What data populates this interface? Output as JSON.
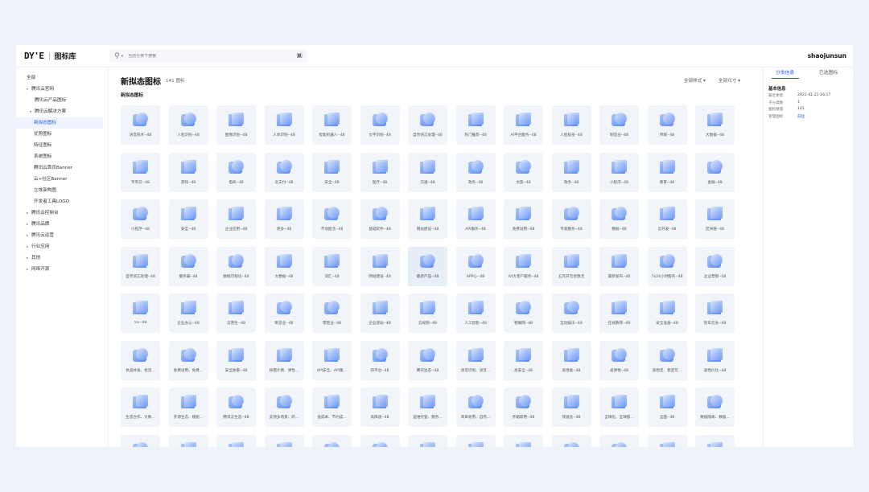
{
  "header": {
    "logo_text": "DY'E",
    "app_title": "图标库",
    "search_placeholder": "当前分类下搜索",
    "username": "shaojunsun"
  },
  "sidebar": {
    "items": [
      {
        "label": "全部",
        "level": 0,
        "expanded": null
      },
      {
        "label": "腾讯云官网",
        "level": 0,
        "expanded": true
      },
      {
        "label": "腾讯云产品图标",
        "level": 2,
        "expanded": null
      },
      {
        "label": "腾讯云解决方案",
        "level": 1,
        "expanded": true
      },
      {
        "label": "新拟态图标",
        "level": 1,
        "active": true,
        "expanded": null
      },
      {
        "label": "优势图标",
        "level": 1,
        "expanded": null
      },
      {
        "label": "特征图标",
        "level": 1,
        "expanded": null
      },
      {
        "label": "系统图标",
        "level": 1,
        "expanded": null
      },
      {
        "label": "腾讯云首页Banner",
        "level": 1,
        "expanded": null
      },
      {
        "label": "云+社区Banner",
        "level": 1,
        "expanded": null
      },
      {
        "label": "立体架构图",
        "level": 1,
        "expanded": null
      },
      {
        "label": "开发者工具LOGO",
        "level": 1,
        "expanded": null
      },
      {
        "label": "腾讯云控制台",
        "level": 0,
        "expanded": false
      },
      {
        "label": "腾讯品牌",
        "level": 0,
        "expanded": false
      },
      {
        "label": "腾讯云运营",
        "level": 0,
        "expanded": false
      },
      {
        "label": "行业应用",
        "level": 0,
        "expanded": false
      },
      {
        "label": "其他",
        "level": 0,
        "expanded": false
      },
      {
        "label": "网络开源",
        "level": 0,
        "expanded": false
      }
    ]
  },
  "main": {
    "title": "新拟态图标",
    "count": "141 图标",
    "filter_style": "全部样式",
    "filter_size": "全部尺寸",
    "section_label": "新拟态图标",
    "icons": [
      "语音技术--48",
      "人脸识别--48",
      "图像识别--48",
      "人体识别--48",
      "智能机器人--48",
      "文字识别--48",
      "自然语言处理--48",
      "热门推荐--48",
      "AI平台服务--48",
      "人脸核身--48",
      "制造业--48",
      "传媒--48",
      "大数据--48",
      "专有云--48",
      "游戏--48",
      "电商--48",
      "云支付--48",
      "安全--48",
      "医疗--48",
      "交通--48",
      "政务--48",
      "文旅--48",
      "政务--48",
      "小程序--48",
      "教育--48",
      "金融--48",
      "小程序--48",
      "安全--48",
      "企业应用--48",
      "更多--48",
      "不动屋活--48",
      "基础软件--48",
      "网站建设--48",
      "API服务--48",
      "免费试用--48",
      "专家服务--48",
      "数据--48",
      "云开发--48",
      "区块链--48",
      "自然语言处理--48",
      "服务器--48",
      "数据可视化--48",
      "大数据--48",
      "词汇--48",
      "网站建设--48",
      "最新产品--48",
      "APP心--48",
      "IVI大客户服务--48",
      "五月开元领激活",
      "最新发布--48",
      "7x24小时服务--48",
      "企业营销--48",
      "5G--48",
      "企业办公--48",
      "云原生--48",
      "制造业--48",
      "零售业--48",
      "企业建站--48",
      "云视频--48",
      "人工智能--48",
      "物联网--48",
      "互动娱乐--48",
      "在线教育--48",
      "安全准备--48",
      "智车云办--48",
      "抗高并发、抗流...",
      "免费试用、免费...",
      "安全防御--48",
      "按需计费、弹性...",
      "API安全、API集...",
      "四平台--48",
      "腾讯生态--48",
      "语音识别、语音...",
      "高安全--48",
      "高性能--48",
      "高弹性--48",
      "高稳定、稳定可...",
      "高性价比--48",
      "生态合作、大数...",
      "开源生态、模组...",
      "腾讯云生态--48",
      "支持多场景、跨...",
      "低成本、节约成...",
      "高降速--48",
      "运维托管、服务...",
      "简单易用、自然...",
      "开箱即用--48",
      "快速迭--48",
      "全球化、全球部...",
      "全面--48",
      "数据隔离、数据...",
      "",
      "",
      "",
      "",
      "",
      "",
      "",
      "",
      "",
      "",
      "",
      "",
      ""
    ]
  },
  "zoom": {
    "level": 0.25,
    "sort_label": "默认"
  },
  "right_panel": {
    "tab_info": "分类信息",
    "tab_selected": "已选图标",
    "info_title": "基本信息",
    "rows": [
      {
        "key": "最近更新",
        "value": "2021-01-21 16:17"
      },
      {
        "key": "子分类数",
        "value": "1"
      },
      {
        "key": "图标数量",
        "value": "141"
      },
      {
        "key": "管理图标",
        "value": "前往"
      }
    ]
  },
  "colors": {
    "accent": "#2a5bd7",
    "card_bg": "#f1f4f8",
    "page_bg": "#eef3fa"
  }
}
